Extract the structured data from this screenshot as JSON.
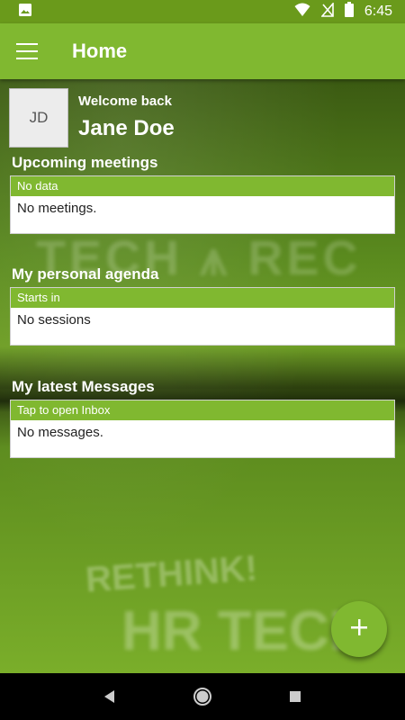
{
  "status_bar": {
    "time": "6:45",
    "icons": [
      "image-icon",
      "wifi-icon",
      "signal-icon",
      "battery-icon"
    ]
  },
  "app_bar": {
    "title": "Home",
    "menu_icon": "hamburger-menu-icon"
  },
  "profile": {
    "initials": "JD",
    "welcome_label": "Welcome back",
    "name": "Jane Doe"
  },
  "sections": {
    "meetings": {
      "title": "Upcoming meetings",
      "header": "No data",
      "body": "No meetings."
    },
    "agenda": {
      "title": "My personal agenda",
      "header": "Starts in",
      "body": "No sessions"
    },
    "messages": {
      "title": "My latest Messages",
      "header": "Tap to open Inbox",
      "body": "No messages."
    }
  },
  "fab": {
    "icon": "plus-icon"
  },
  "nav_bar": {
    "icons": [
      "back-icon",
      "home-icon",
      "recents-icon"
    ]
  },
  "colors": {
    "accent": "#80b830",
    "status_bar": "#6a9a1b"
  }
}
